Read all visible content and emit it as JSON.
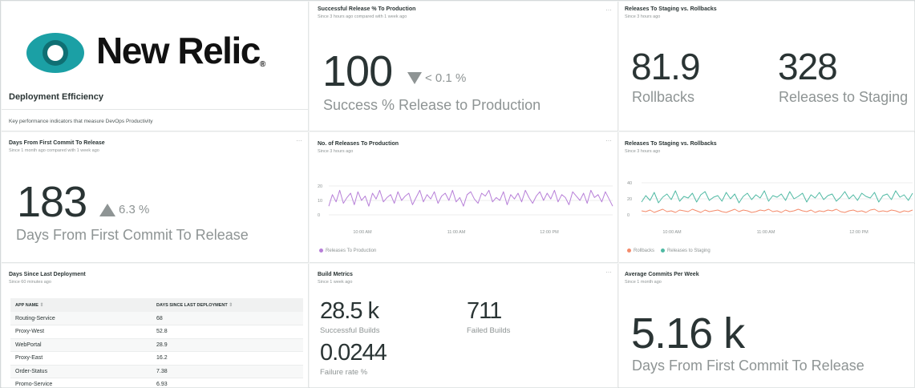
{
  "brand": {
    "name": "New Relic",
    "registered": "®",
    "logo_outer": "#1ba0a5",
    "logo_inner": "#ffffff",
    "logo_ring": "#0f6f73"
  },
  "intro": {
    "title": "Deployment Efficiency",
    "description": "Key performance indicators that measure DevOps Productivity"
  },
  "menu_glyph": "…",
  "success_release": {
    "title": "Successful Release % To Production",
    "subtitle": "Since 3 hours ago compared with 1 week ago",
    "value": "100",
    "delta": "< 0.1 %",
    "delta_direction": "down",
    "label": "Success % Release to Production"
  },
  "staging_vs_rollbacks_stats": {
    "title": "Releases To Staging vs. Rollbacks",
    "subtitle": "Since 3 hours ago",
    "rollbacks_value": "81.9",
    "rollbacks_label": "Rollbacks",
    "staging_value": "328",
    "staging_label": "Releases to Staging"
  },
  "days_first_commit": {
    "title": "Days From First Commit To Release",
    "subtitle": "Since 1 month ago compared with 1 week ago",
    "value": "183",
    "delta": "6.3 %",
    "delta_direction": "up",
    "label": "Days From First Commit To Release"
  },
  "releases_chart_panel": {
    "title": "No. of Releases To Production",
    "subtitle": "Since 3 hours ago",
    "legend": "Releases To Production"
  },
  "staging_rollbacks_chart_panel": {
    "title": "Releases To Staging vs. Rollbacks",
    "subtitle": "Since 3 hours ago",
    "legend_rollbacks": "Rollbacks",
    "legend_staging": "Releases to Staging"
  },
  "chart_data": [
    {
      "type": "line",
      "title": "No. of Releases To Production",
      "y_ticks": [
        "20",
        "10",
        "0"
      ],
      "ylim": [
        0,
        25
      ],
      "x_ticks": [
        "10:00 AM",
        "11:00 AM",
        "12:00 PM"
      ],
      "grid": true,
      "legend_placement": "bottom-left",
      "series": [
        {
          "name": "Releases To Production",
          "color": "#b77fd8",
          "values": [
            6,
            14,
            9,
            17,
            8,
            12,
            15,
            7,
            16,
            10,
            13,
            6,
            15,
            11,
            17,
            9,
            12,
            14,
            8,
            16,
            10,
            13,
            15,
            7,
            12,
            17,
            9,
            14,
            11,
            16,
            8,
            13,
            15,
            10,
            17,
            9,
            12,
            6,
            14,
            16,
            11,
            8,
            15,
            13,
            17,
            9,
            12,
            10,
            16,
            7,
            14,
            11,
            15,
            9,
            17,
            12,
            8,
            13,
            16,
            10,
            15,
            11,
            17,
            9,
            14,
            12,
            7,
            16,
            13,
            10,
            15,
            8,
            17,
            12,
            14,
            9,
            16,
            11,
            6
          ]
        }
      ]
    },
    {
      "type": "line",
      "title": "Releases To Staging vs. Rollbacks",
      "y_ticks": [
        "40",
        "20",
        "0"
      ],
      "ylim": [
        0,
        45
      ],
      "x_ticks": [
        "10:00 AM",
        "11:00 AM",
        "12:00 PM"
      ],
      "grid": true,
      "legend_placement": "bottom-left",
      "series": [
        {
          "name": "Rollbacks",
          "color": "#f48b6b",
          "values": [
            5,
            4,
            6,
            3,
            5,
            7,
            4,
            5,
            3,
            6,
            5,
            4,
            7,
            5,
            3,
            6,
            4,
            5,
            6,
            4,
            3,
            5,
            7,
            4,
            6,
            5,
            3,
            4,
            6,
            5,
            7,
            4,
            5,
            3,
            6,
            4,
            5,
            7,
            5,
            4,
            6,
            3,
            5,
            4,
            6,
            5,
            7,
            4,
            3,
            5,
            6,
            4,
            5,
            3,
            6,
            7,
            4,
            5,
            4,
            6,
            5,
            3,
            5,
            4,
            6
          ]
        },
        {
          "name": "Releases to Staging",
          "color": "#4fb9a3",
          "values": [
            16,
            24,
            18,
            28,
            15,
            22,
            26,
            19,
            30,
            17,
            23,
            21,
            27,
            16,
            25,
            29,
            18,
            22,
            24,
            17,
            28,
            20,
            26,
            15,
            23,
            27,
            19,
            25,
            21,
            30,
            17,
            24,
            22,
            26,
            18,
            29,
            20,
            23,
            27,
            16,
            25,
            21,
            28,
            19,
            24,
            26,
            17,
            22,
            29,
            20,
            25,
            18,
            27,
            23,
            21,
            28,
            16,
            24,
            26,
            19,
            30,
            22,
            25,
            18,
            27
          ]
        }
      ]
    }
  ],
  "days_since_deploy": {
    "title": "Days Since Last Deployment",
    "subtitle": "Since 60 minutes ago",
    "columns": [
      "APP NAME",
      "DAYS SINCE LAST DEPLOYMENT"
    ],
    "sort_glyph": "⇕",
    "rows": [
      [
        "Routing-Service",
        "68"
      ],
      [
        "Proxy-West",
        "52.8"
      ],
      [
        "WebPortal",
        "28.9"
      ],
      [
        "Proxy-East",
        "16.2"
      ],
      [
        "Order-Status",
        "7.38"
      ],
      [
        "Promo-Service",
        "6.93"
      ]
    ]
  },
  "build_metrics": {
    "title": "Build Metrics",
    "subtitle": "Since 1 week ago",
    "successful_value": "28.5 k",
    "successful_label": "Successful Builds",
    "failed_value": "711",
    "failed_label": "Failed Builds",
    "failure_rate_value": "0.0244",
    "failure_rate_label": "Failure rate %"
  },
  "avg_commits": {
    "title": "Average Commits Per Week",
    "subtitle": "Since 1 month ago",
    "value": "5.16 k",
    "label": "Days From First Commit To Release"
  }
}
